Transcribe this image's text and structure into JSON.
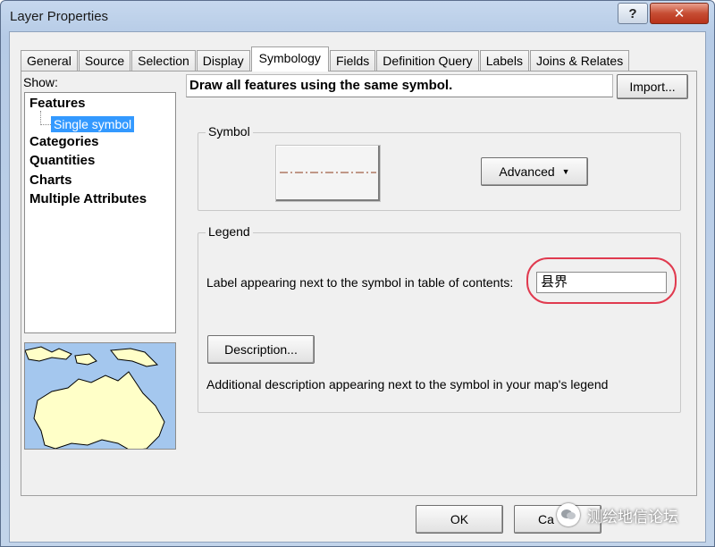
{
  "window": {
    "title": "Layer Properties",
    "help_label": "?",
    "close_label": "✕"
  },
  "tabs": [
    {
      "label": "General"
    },
    {
      "label": "Source"
    },
    {
      "label": "Selection"
    },
    {
      "label": "Display"
    },
    {
      "label": "Symbology",
      "active": true
    },
    {
      "label": "Fields"
    },
    {
      "label": "Definition Query"
    },
    {
      "label": "Labels"
    },
    {
      "label": "Joins & Relates"
    }
  ],
  "show_panel": {
    "label": "Show:",
    "items": [
      "Features",
      "Categories",
      "Quantities",
      "Charts",
      "Multiple Attributes"
    ],
    "selected_child": "Single symbol"
  },
  "description_bar": {
    "text": "Draw all features using the same symbol.",
    "import_label": "Import..."
  },
  "symbol_group": {
    "title": "Symbol",
    "line_color": "#8b3a1a",
    "advanced_label": "Advanced"
  },
  "legend_group": {
    "title": "Legend",
    "label_prompt": "Label appearing next to the symbol in table of contents:",
    "label_value": "县界",
    "description_button": "Description...",
    "additional_text": "Additional description appearing next to the symbol in your map's legend"
  },
  "footer": {
    "ok_label": "OK",
    "cancel_label": "Ca"
  },
  "watermark": {
    "text": "测绘地信论坛"
  },
  "colors": {
    "highlight_ring": "#e03a4f",
    "selection": "#3399ff",
    "map_water": "#a4c7ee",
    "map_land": "#ffffc8"
  }
}
